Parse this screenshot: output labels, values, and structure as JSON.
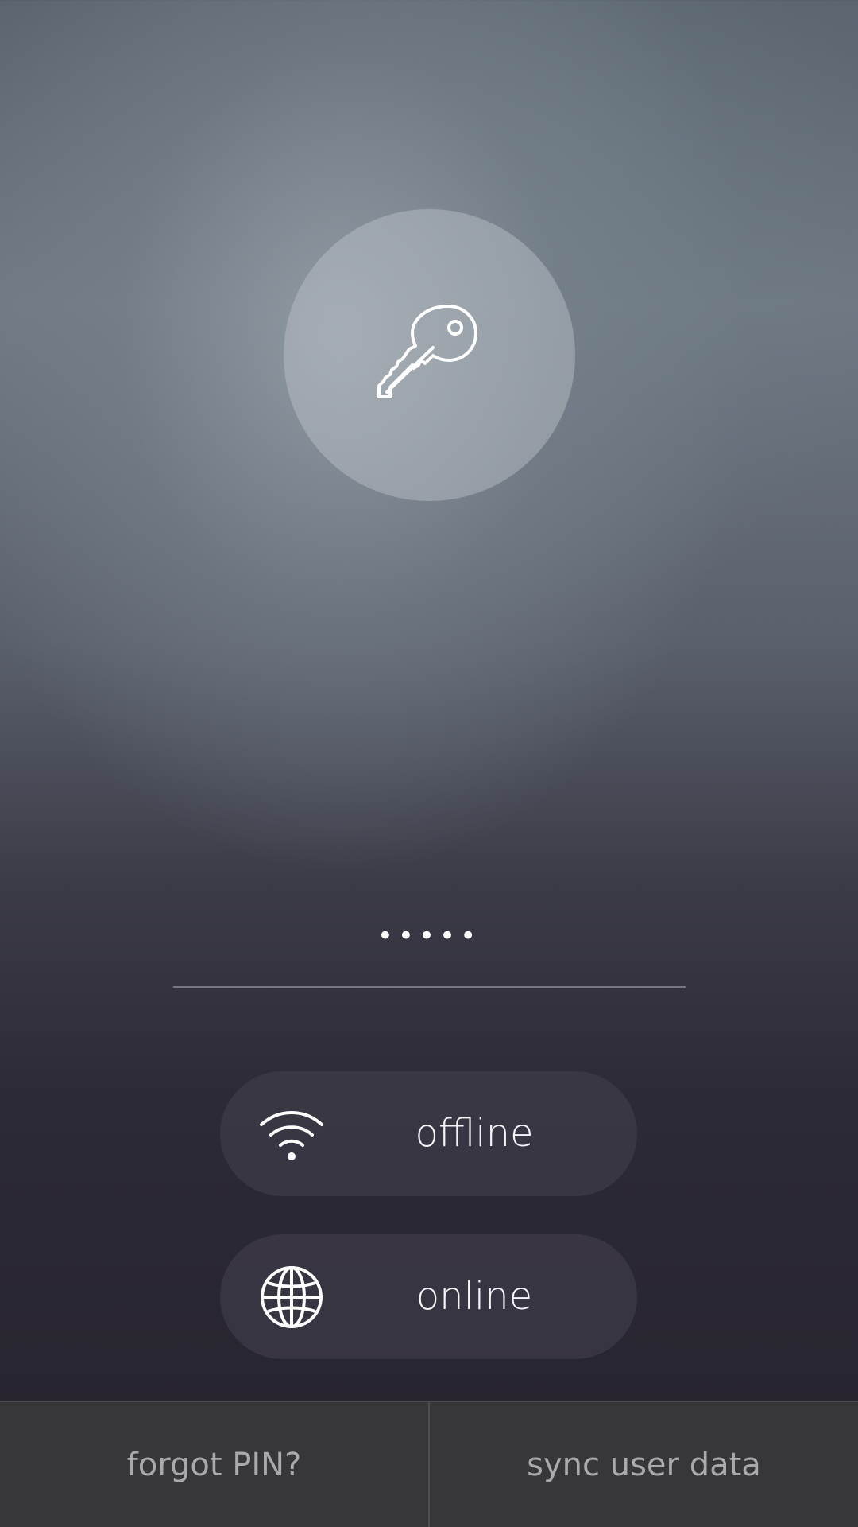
{
  "pin": {
    "masked_value": "•••••",
    "icon": "key-icon"
  },
  "modes": [
    {
      "label": "offline",
      "icon": "wifi-icon"
    },
    {
      "label": "online",
      "icon": "globe-icon"
    }
  ],
  "footer": {
    "forgot_label": "forgot PIN?",
    "sync_label": "sync user data"
  },
  "colors": {
    "icon_stroke": "#ffffff",
    "footer_bg": "#373739",
    "footer_text": "#a9a9ae"
  }
}
